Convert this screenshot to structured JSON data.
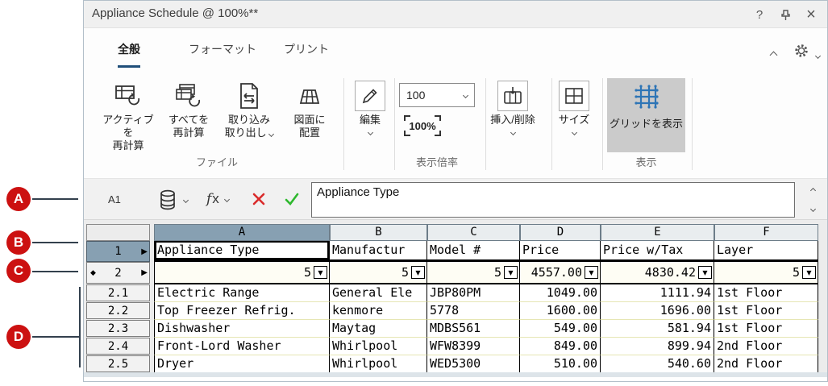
{
  "window": {
    "title": "Appliance Schedule @ 100%**"
  },
  "tabs": {
    "general": "全般",
    "format": "フォーマット",
    "print": "プリント"
  },
  "ribbon": {
    "file": {
      "group_label": "ファイル",
      "recalc_active": "アクティブを\n再計算",
      "recalc_all": "すべてを\n再計算",
      "import_export": "取り込み\n取り出し",
      "place_on_drawing": "図面に\n配置"
    },
    "edit": {
      "label": "編集"
    },
    "zoom": {
      "group_label": "表示倍率",
      "combo_value": "100",
      "reset_label": "100%"
    },
    "insert_delete": {
      "label": "挿入/削除"
    },
    "size": {
      "label": "サイズ"
    },
    "view": {
      "group_label": "表示",
      "show_grid_label": "グリッドを表示"
    }
  },
  "formula_bar": {
    "cell_ref": "A1",
    "value": "Appliance Type"
  },
  "sheet": {
    "column_letters": [
      "A",
      "B",
      "C",
      "D",
      "E",
      "F"
    ],
    "header_row": {
      "num": "1",
      "cells": [
        "Appliance Type",
        "Manufactur",
        "Model #",
        "Price",
        "Price w/Tax",
        "Layer"
      ]
    },
    "summary_row": {
      "num": "2",
      "cells": [
        "5",
        "5",
        "5",
        "4557.00",
        "4830.42",
        "5"
      ]
    },
    "data_rows": [
      {
        "num": "2.1",
        "cells": [
          "Electric Range",
          "General Ele",
          "JBP80PM",
          "1049.00",
          "1111.94",
          "1st Floor"
        ]
      },
      {
        "num": "2.2",
        "cells": [
          "Top Freezer Refrig.",
          "kenmore",
          "5778",
          "1600.00",
          "1696.00",
          "1st Floor"
        ]
      },
      {
        "num": "2.3",
        "cells": [
          "Dishwasher",
          "Maytag",
          "MDBS561",
          "549.00",
          "581.94",
          "1st Floor"
        ]
      },
      {
        "num": "2.4",
        "cells": [
          "Front-Lord Washer",
          "Whirlpool",
          "WFW8399",
          "849.00",
          "899.94",
          "2nd Floor"
        ]
      },
      {
        "num": "2.5",
        "cells": [
          "Dryer",
          "Whirlpool",
          "WED5300",
          "510.00",
          "540.60",
          "2nd Floor"
        ]
      }
    ]
  },
  "callouts": {
    "a": "A",
    "b": "B",
    "c": "C",
    "d": "D"
  },
  "colors": {
    "accent_blue": "#1f4e79",
    "header_blue_gray": "#87a0b2",
    "grid_icon_blue": "#2e75b6",
    "callout_red": "#cc1111",
    "cancel_red": "#d92b2b",
    "confirm_green": "#2eb82e"
  }
}
